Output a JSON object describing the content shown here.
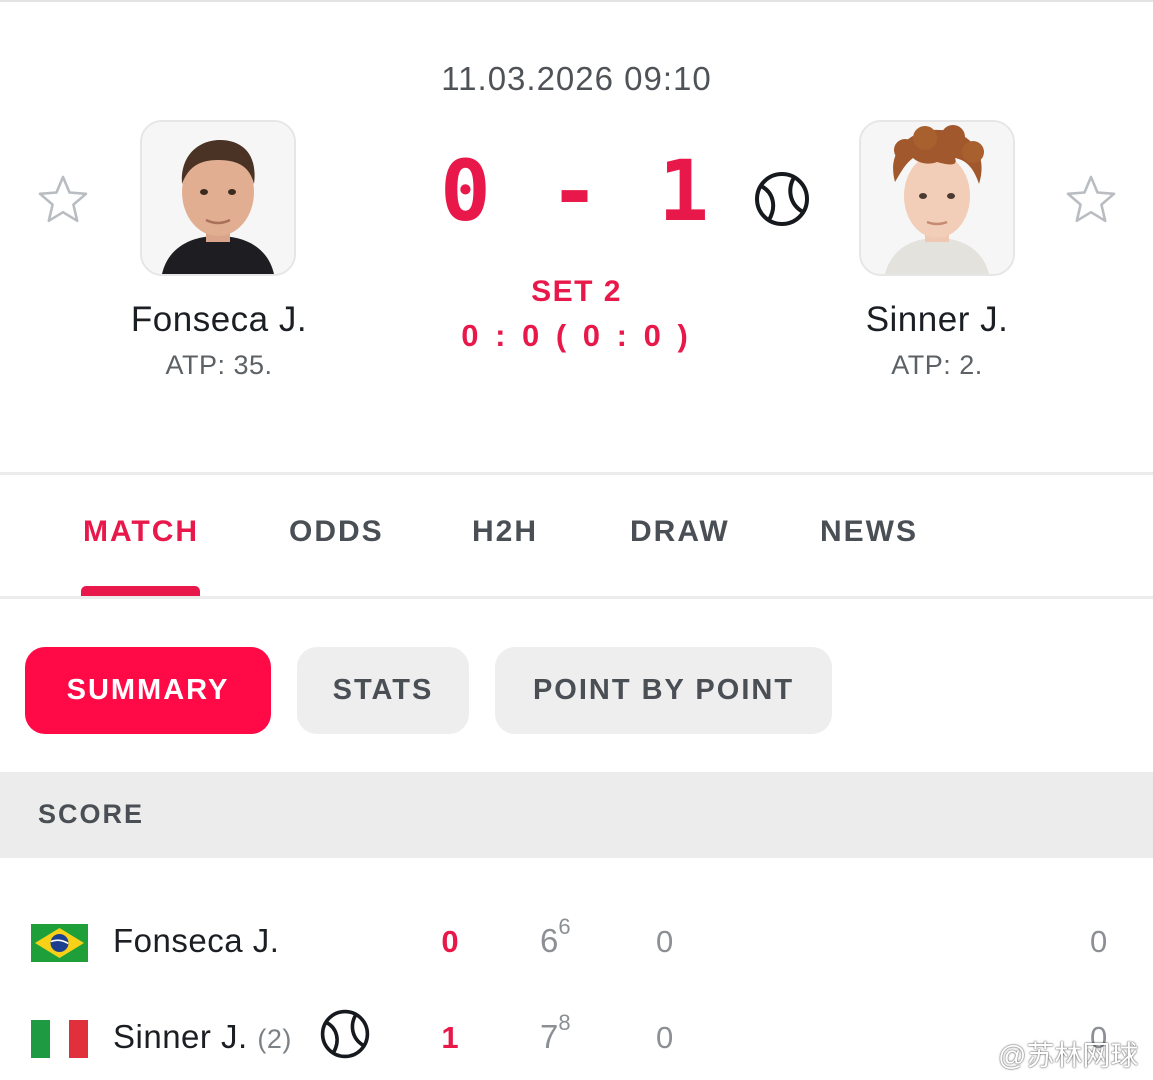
{
  "match": {
    "datetime": "11.03.2026 09:10",
    "score": "0 - 1",
    "set_label": "SET 2",
    "set_score": "0 : 0 ( 0 : 0 )"
  },
  "players": {
    "left": {
      "name": "Fonseca J.",
      "rank": "ATP: 35.",
      "avatar": "fonseca-photo",
      "flag": "brazil-flag"
    },
    "right": {
      "name": "Sinner J.",
      "rank": "ATP: 2.",
      "avatar": "sinner-photo",
      "flag": "italy-flag"
    }
  },
  "icons": {
    "favorite": "star-outline-icon",
    "serve": "tennis-ball-icon"
  },
  "tabs": [
    {
      "label": "MATCH",
      "active": true
    },
    {
      "label": "ODDS",
      "active": false
    },
    {
      "label": "H2H",
      "active": false
    },
    {
      "label": "DRAW",
      "active": false
    },
    {
      "label": "NEWS",
      "active": false
    }
  ],
  "subtabs": [
    {
      "label": "SUMMARY",
      "active": true
    },
    {
      "label": "STATS",
      "active": false
    },
    {
      "label": "POINT BY POINT",
      "active": false
    }
  ],
  "score_section": {
    "title": "SCORE",
    "rows": [
      {
        "name": "Fonseca J.",
        "seed": "",
        "total": "0",
        "set1": "6",
        "set1_tiebreak": "6",
        "set2": "0",
        "points": "0"
      },
      {
        "name": "Sinner J.",
        "seed": "(2)",
        "total": "1",
        "set1": "7",
        "set1_tiebreak": "8",
        "set2": "0",
        "points": "0"
      }
    ]
  },
  "watermark": "@苏林网球",
  "colors": {
    "accent": "#e8194a",
    "pill_active": "#ff0a47",
    "muted": "#8c9094",
    "section_bg": "#ececec"
  }
}
